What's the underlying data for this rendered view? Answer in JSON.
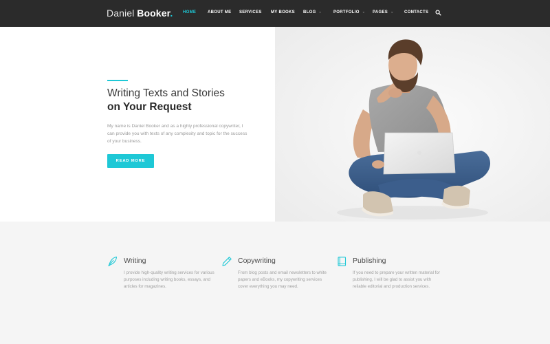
{
  "logo": {
    "first": "Daniel",
    "last": "Booker",
    "dot": "."
  },
  "nav": {
    "items": [
      {
        "label": "HOME",
        "active": true
      },
      {
        "label": "ABOUT ME"
      },
      {
        "label": "SERVICES"
      },
      {
        "label": "MY BOOKS"
      },
      {
        "label": "BLOG",
        "dropdown": true
      },
      {
        "label": "PORTFOLIO",
        "dropdown": true
      },
      {
        "label": "PAGES",
        "dropdown": true
      },
      {
        "label": "CONTACTS"
      }
    ],
    "search_icon": "search-icon",
    "caret_glyph": "⌄"
  },
  "hero": {
    "title_line1": "Writing Texts and Stories",
    "title_line2": "on Your Request",
    "description": "My name is Daniel Booker and as a highly professional copywriter, I can provide you with texts of any complexity and topic for the success of your business.",
    "button_label": "READ MORE",
    "image": "man-with-laptop-photo"
  },
  "services": [
    {
      "icon": "quill-icon",
      "title": "Writing",
      "description": "I provide high-quality writing services for various purposes including writing books, essays, and articles for magazines."
    },
    {
      "icon": "pen-icon",
      "title": "Copywriting",
      "description": "From blog posts and email newsletters to white papers and eBooks, my copywriting services cover everything you may need."
    },
    {
      "icon": "book-icon",
      "title": "Publishing",
      "description": "If you need to prepare your written material for publishing, I will be glad to assist you with reliable editorial and production services."
    }
  ],
  "colors": {
    "accent": "#1ec8d6",
    "nav_background": "#2b2b2b",
    "services_background": "#f5f5f5"
  }
}
